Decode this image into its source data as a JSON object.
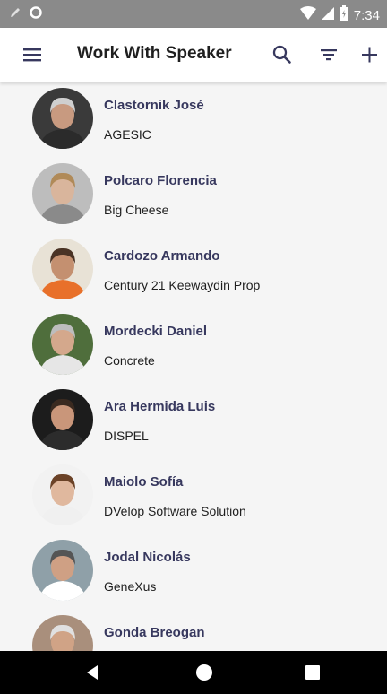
{
  "status_bar": {
    "time": "7:34",
    "icons": [
      "pencil-icon",
      "circle-notification-icon",
      "wifi-icon",
      "cell-signal-icon",
      "battery-icon"
    ]
  },
  "app_bar": {
    "title": "Work With Speaker",
    "actions": [
      "menu-icon",
      "search-icon",
      "filter-icon",
      "add-icon"
    ]
  },
  "speakers": [
    {
      "name": "Clastornik José",
      "company": "AGESIC",
      "bg": "#3a3a3a",
      "skin": "#c89a80",
      "hair": "#cfcfcf",
      "shirt": "#2b2b2b"
    },
    {
      "name": "Polcaro Florencia",
      "company": "Big Cheese",
      "bg": "#bdbdbd",
      "skin": "#d9b59c",
      "hair": "#b08a58",
      "shirt": "#8a8a8a"
    },
    {
      "name": "Cardozo Armando",
      "company": "Century 21 Keewaydin Prop",
      "bg": "#e8e2d6",
      "skin": "#c49070",
      "hair": "#4a3325",
      "shirt": "#e8702a"
    },
    {
      "name": "Mordecki Daniel",
      "company": "Concrete",
      "bg": "#4f6e3c",
      "skin": "#d4a88c",
      "hair": "#bdbdbd",
      "shirt": "#e6e6e6"
    },
    {
      "name": "Ara Hermida Luis",
      "company": "DISPEL",
      "bg": "#1c1c1c",
      "skin": "#c9967a",
      "hair": "#3a2a20",
      "shirt": "#2c2c2c"
    },
    {
      "name": "Maiolo Sofía",
      "company": "DVelop Software Solution",
      "bg": "#f2f2f2",
      "skin": "#e0b89e",
      "hair": "#6b4227",
      "shirt": "#f0f0f0"
    },
    {
      "name": "Jodal Nicolás",
      "company": "GeneXus",
      "bg": "#8fa0a8",
      "skin": "#cfa084",
      "hair": "#555555",
      "shirt": "#ffffff"
    },
    {
      "name": "Gonda Breogan",
      "company": "",
      "bg": "#a98f7c",
      "skin": "#d0a386",
      "hair": "#e0e0e0",
      "shirt": "#6a6a6a"
    }
  ],
  "nav_bar": {
    "buttons": [
      "back-icon",
      "home-icon",
      "recents-icon"
    ]
  }
}
